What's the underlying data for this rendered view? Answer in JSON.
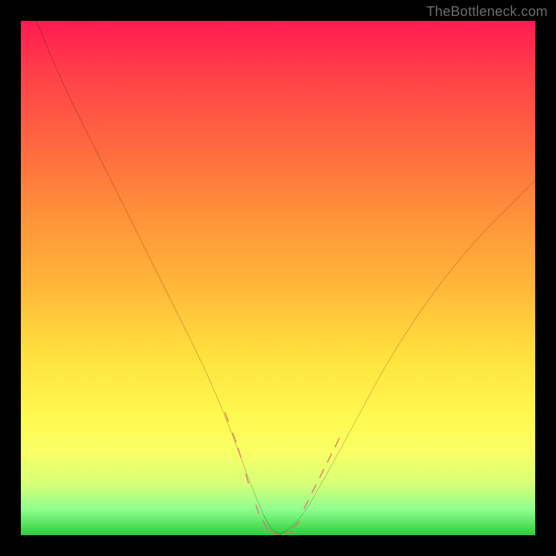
{
  "watermark": "TheBottleneck.com",
  "colors": {
    "background_frame": "#000000",
    "curve": "#000000",
    "marker_fill": "#e66a6a",
    "marker_stroke": "#e66a6a",
    "gradient_top": "#ff1a51",
    "gradient_bottom": "#2dce3b"
  },
  "chart_data": {
    "type": "line",
    "title": "",
    "xlabel": "",
    "ylabel": "",
    "xlim": [
      0,
      100
    ],
    "ylim": [
      0,
      100
    ],
    "grid": false,
    "note": "V-shaped bottleneck curve. X is relative component balance (approx %), Y is bottleneck percentage (0 at valley, ~100 at edges). Values estimated from gradient position; minimum at ~50.",
    "series": [
      {
        "name": "bottleneck-curve",
        "x": [
          3,
          8,
          15,
          22,
          29,
          36,
          41,
          45,
          48,
          50,
          52,
          55,
          59,
          65,
          72,
          80,
          88,
          96,
          100
        ],
        "y": [
          100,
          88,
          74,
          60,
          46,
          32,
          20,
          9,
          2,
          0,
          1,
          4,
          11,
          22,
          35,
          47,
          57,
          65,
          69
        ]
      }
    ],
    "markers": {
      "name": "highlighted-points",
      "note": "Salmon oblong markers clustered on both flanks near the valley and along the valley floor.",
      "x": [
        40,
        41.5,
        42.5,
        44,
        46,
        47.5,
        49,
        50.5,
        52,
        53.5,
        55.5,
        57,
        58.5,
        60,
        61.5
      ],
      "y": [
        23,
        19,
        16,
        11,
        5,
        2,
        0.5,
        0,
        0.5,
        2,
        6,
        9,
        12,
        15,
        18
      ]
    }
  }
}
